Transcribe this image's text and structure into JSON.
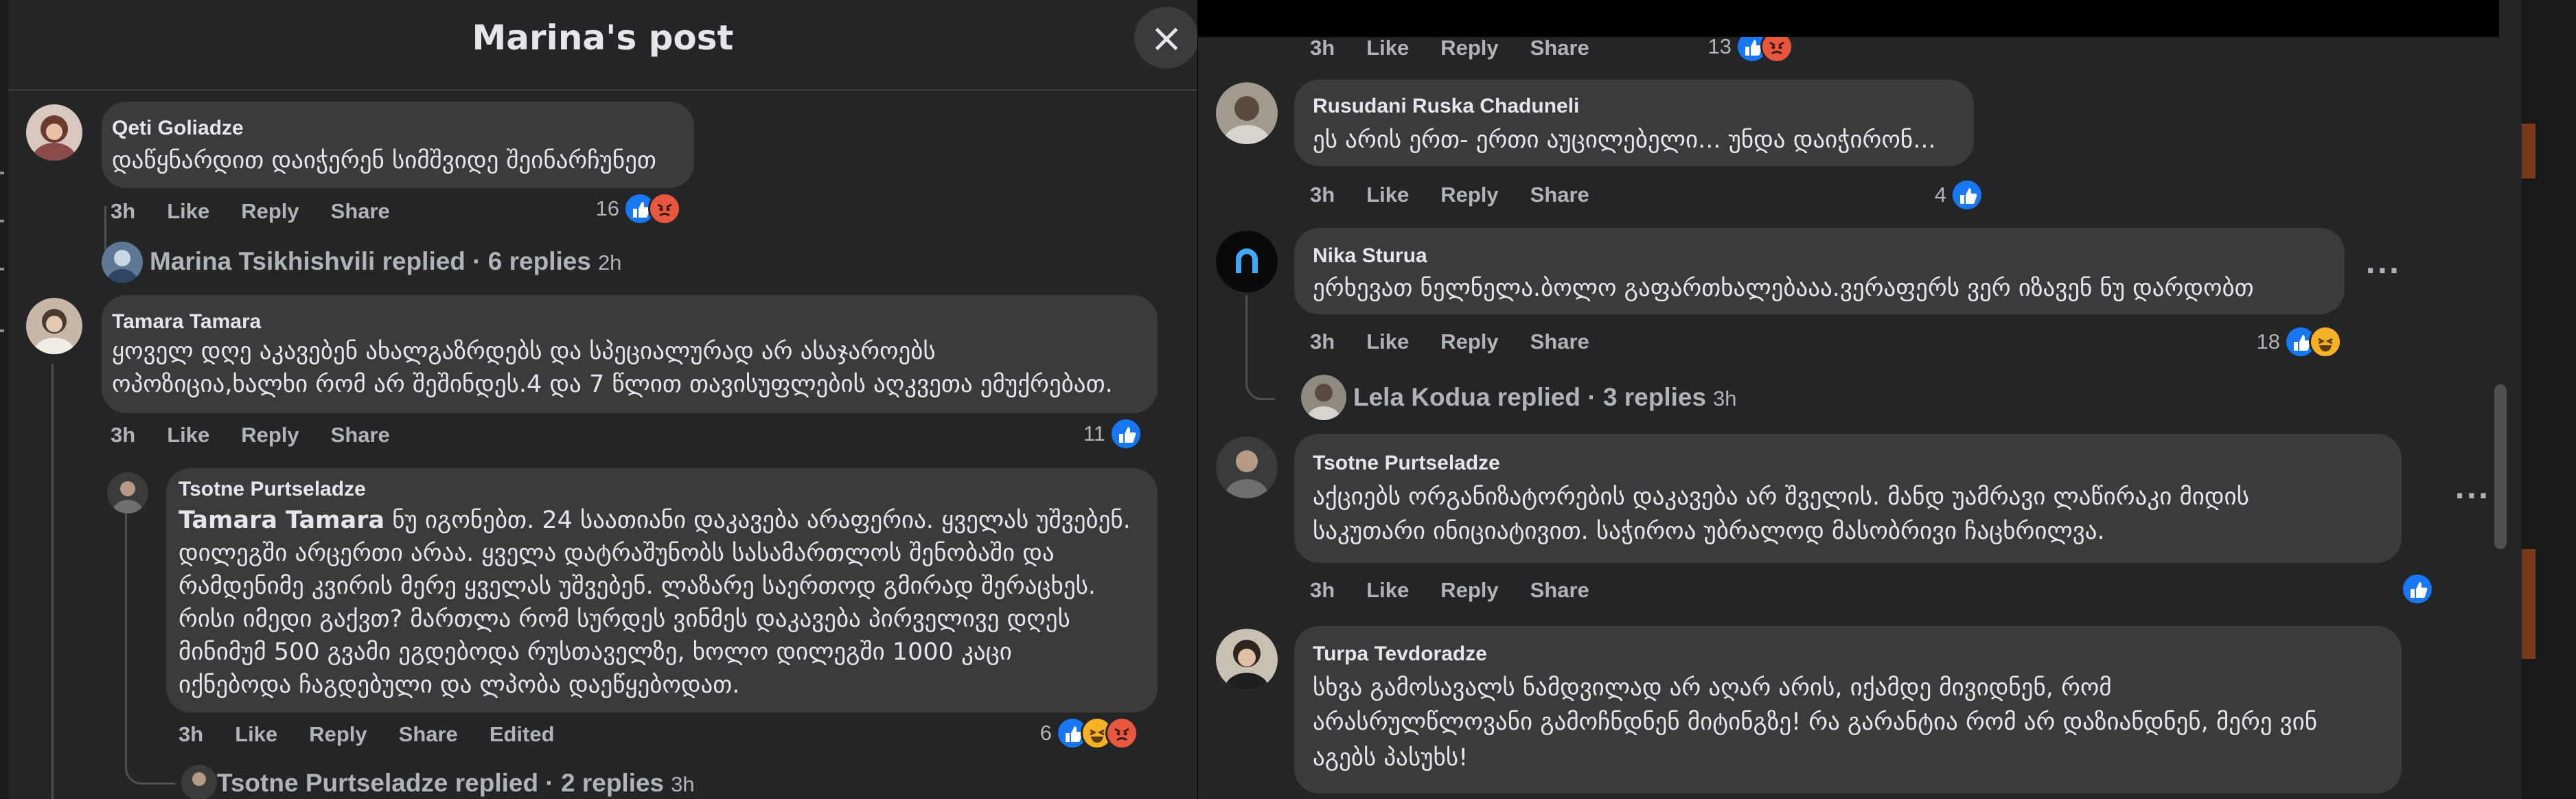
{
  "post_title": "Marina's post",
  "close_icon": "×",
  "colors": {
    "like": "#1877f2",
    "angry": "#e9573f",
    "haha": "#f7b125",
    "bubble": "#3a3b3c",
    "panel": "#242526"
  },
  "actions": {
    "like": "Like",
    "reply": "Reply",
    "share": "Share",
    "edited": "Edited"
  },
  "left": {
    "c1": {
      "author": "Qeti Goliadze",
      "text": "დაწყნარდით დაიჭერენ სიმშვიდე შეინარჩუნეთ",
      "time": "3h",
      "count": "16"
    },
    "r1": {
      "text": "Marina Tsikhishvili replied · 6 replies",
      "time": "2h"
    },
    "c2": {
      "author": "Tamara Tamara",
      "line1": "ყოველ დღე აკავებენ ახალგაზრდებს და სპეციალურად არ ასაჯაროებს",
      "line2": "ოპოზიცია,ხალხი რომ არ შეშინდეს.4 და 7 წლით თავისუფლების აღკვეთა ემუქრებათ.",
      "time": "3h",
      "count": "11"
    },
    "c3": {
      "author": "Tsotne Purtseladze",
      "mention": "Tamara Tamara",
      "line1": " ნუ იგონებთ. 24 საათიანი დაკავება არაფერია. ყველას უშვებენ.",
      "line2": "დილეგში არცერთი არაა. ყველა დატრაშუნობს სასამართლოს შენობაში და",
      "line3": "რამდენიმე კვირის მერე ყველას უშვებენ. ლაზარე საერთოდ გმირად შერაცხეს.",
      "line4": "რისი იმედი გაქვთ? მართლა რომ სურდეს ვინმეს დაკავება პირველივე დღეს",
      "line5": "მინიმუმ 500 გვამი ეგდებოდა რუსთაველზე, ხოლო დილეგში 1000 კაცი",
      "line6": "იქნებოდა ჩაგდებული და ლპობა დაეწყებოდათ.",
      "time": "3h",
      "count": "6"
    },
    "r2": {
      "text": "Tsotne Purtseladze replied · 2 replies",
      "time": "3h"
    }
  },
  "right": {
    "c0": {
      "time": "3h",
      "count": "13"
    },
    "c1": {
      "author": "Rusudani Ruska Chaduneli",
      "text": "ეს არის ერთ- ერთი აუცილებელი... უნდა დაიჭირონ...",
      "time": "3h",
      "count": "4"
    },
    "c2": {
      "author": "Nika Sturua",
      "text": "ერხევათ ნელნელა.ბოლო გაფართხალებააა.ვერაფერს ვერ იზავენ ნუ დარდობთ",
      "time": "3h",
      "count": "18",
      "more": "···"
    },
    "r1": {
      "text": "Lela Kodua replied · 3 replies",
      "time": "3h"
    },
    "c3": {
      "author": "Tsotne Purtseladze",
      "line1": "აქციებს ორგანიზატორების დაკავება არ შველის. მანდ უამრავი ლაწირაკი მიდის",
      "line2": "საკუთარი ინიციატივით. საჭიროა უბრალოდ მასობრივი ჩაცხრილვა.",
      "time": "3h",
      "more": "···"
    },
    "c4": {
      "author": "Turpa Tevdoradze",
      "line1": "სხვა გამოსავალს ნამდვილად არ აღარ არის, იქამდე მივიდნენ, რომ",
      "line2": "არასრულწლოვანი გამოჩნდნენ მიტინგზე! რა გარანტია რომ არ დაზიანდნენ, მერე ვინ",
      "line3": "აგებს პასუხს!"
    }
  }
}
